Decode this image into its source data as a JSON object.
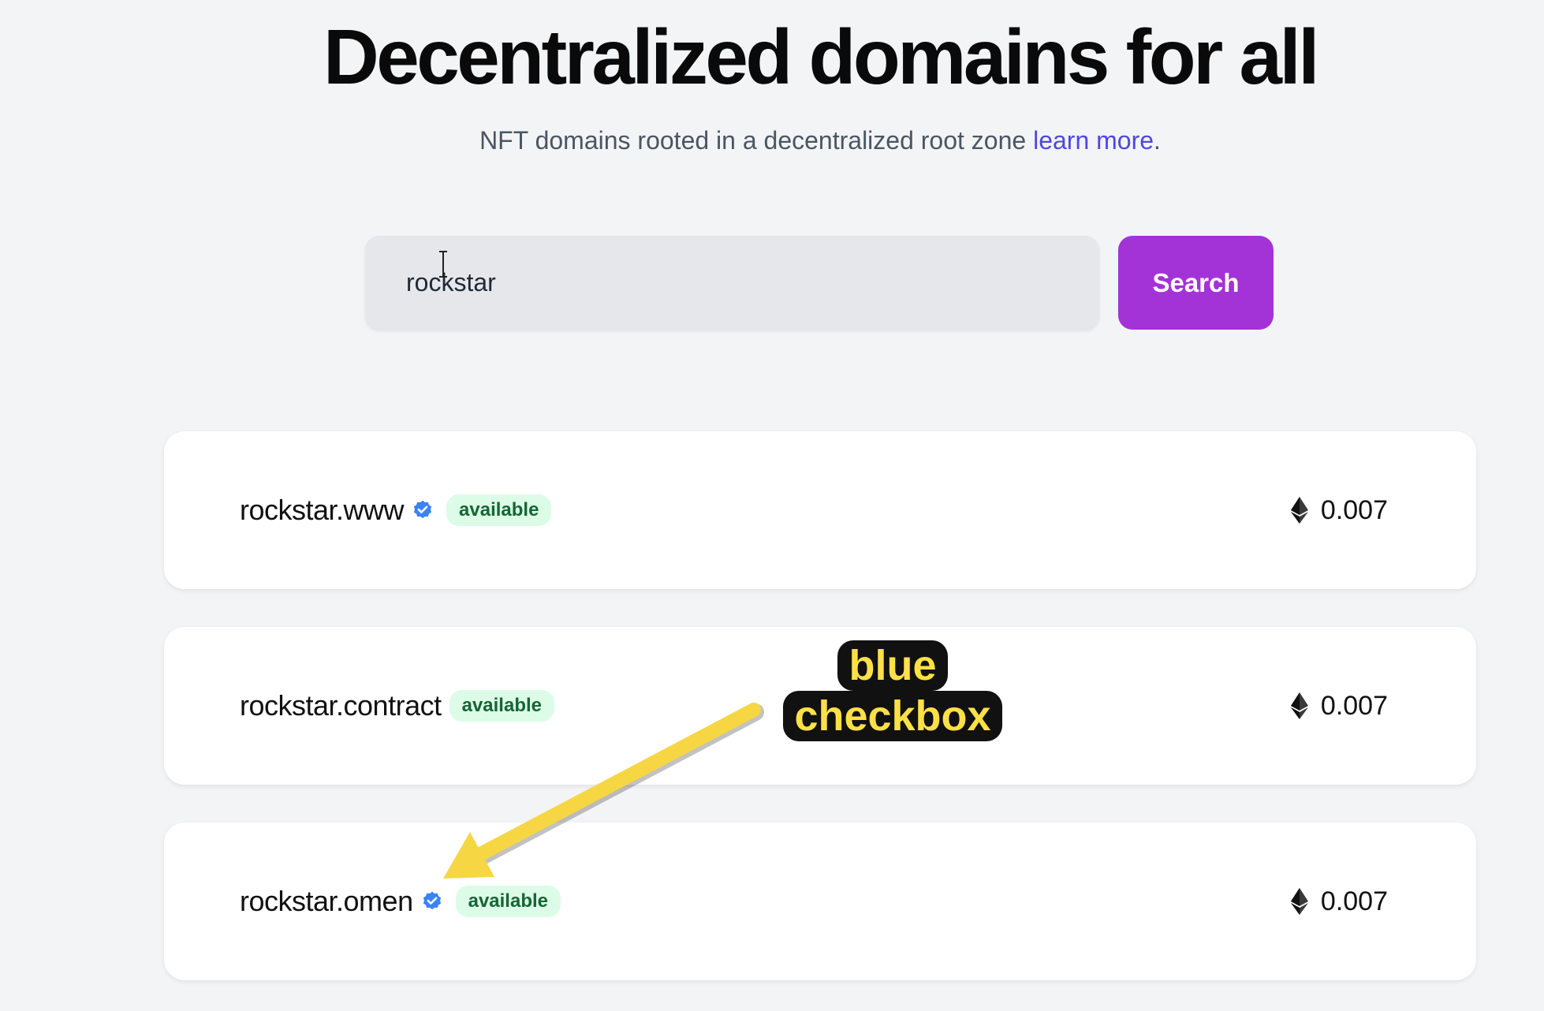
{
  "hero": {
    "title": "Decentralized domains for all",
    "subtitle": "NFT domains rooted in a decentralized root zone ",
    "link_label": "learn more",
    "period": "."
  },
  "search": {
    "value": "rockstar",
    "button_label": "Search"
  },
  "results": [
    {
      "domain": "rockstar.www",
      "verified": true,
      "status": "available",
      "price": "0.007"
    },
    {
      "domain": "rockstar.contract",
      "verified": false,
      "status": "available",
      "price": "0.007"
    },
    {
      "domain": "rockstar.omen",
      "verified": true,
      "status": "available",
      "price": "0.007"
    }
  ],
  "annotation": {
    "line1": "blue",
    "line2": "checkbox"
  },
  "colors": {
    "accent": "#a333d6",
    "link": "#4f46e5",
    "verified": "#3b82f6",
    "badge_bg": "#dcfce7",
    "badge_text": "#166534",
    "annotation_fill": "#fde047"
  },
  "icons": {
    "verified": "verified-badge-icon",
    "currency": "ethereum-icon",
    "cursor": "text-cursor-icon"
  }
}
